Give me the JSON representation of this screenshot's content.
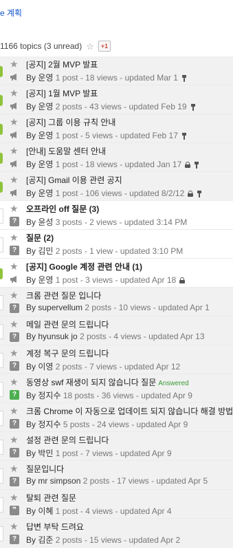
{
  "top_link": "e 계획",
  "summary": {
    "text": "1166 topics (3 unread)",
    "gplus_label": "+1"
  },
  "topics": [
    {
      "title": "[공지] 2월 MVP 발표",
      "meta_by": "By",
      "author": "운영",
      "meta": "1 post - 18 views - updated Mar 1",
      "state": "read",
      "badge": "green",
      "type": "announce",
      "pinned": true,
      "locked": false,
      "answered": false
    },
    {
      "title": "[공지] 1월 MVP 발표",
      "meta_by": "By",
      "author": "운영",
      "meta": "2 posts - 43 views - updated Feb 19",
      "state": "read",
      "badge": "green",
      "type": "announce",
      "pinned": true,
      "locked": false,
      "answered": false
    },
    {
      "title": "[공지] 그룹 이용 규칙 안내",
      "meta_by": "By",
      "author": "운영",
      "meta": "1 post - 5 views - updated Feb 17",
      "state": "read",
      "badge": "green",
      "type": "announce",
      "pinned": true,
      "locked": false,
      "answered": false
    },
    {
      "title": "[안내] 도움말 센터 안내",
      "meta_by": "By",
      "author": "운영",
      "meta": "1 post - 18 views - updated Jan 17",
      "state": "read",
      "badge": "green",
      "type": "announce",
      "pinned": true,
      "locked": true,
      "answered": false
    },
    {
      "title": "[공지] Gmail 이용 관련 공지",
      "meta_by": "By",
      "author": "운영",
      "meta": "1 post - 106 views - updated 8/2/12",
      "state": "read",
      "badge": "green",
      "type": "announce",
      "pinned": true,
      "locked": true,
      "answered": false
    },
    {
      "title": "오프라인 off 질문 (3)",
      "meta_by": "By",
      "author": "윤성",
      "meta": "3 posts - 2 views - updated 3:14 PM",
      "state": "unread",
      "badge": "white",
      "type": "q",
      "pinned": false,
      "locked": false,
      "answered": false
    },
    {
      "title": "질문 (2)",
      "meta_by": "By",
      "author": "김민",
      "meta": "2 posts - 1 view - updated 3:10 PM",
      "state": "unread",
      "badge": "white",
      "type": "q",
      "pinned": false,
      "locked": false,
      "answered": false
    },
    {
      "title": "[공지] Google 계정 관련 안내 (1)",
      "meta_by": "By",
      "author": "운영",
      "meta": "1 post - 3 views - updated Apr 18",
      "state": "unread",
      "badge": "green",
      "type": "announce",
      "pinned": false,
      "locked": true,
      "answered": false
    },
    {
      "title": "크롬 관련 질문 입니다",
      "meta_by": "By",
      "author": "supervellum",
      "meta": "2 posts - 10 views - updated Apr 1",
      "state": "read",
      "badge": "white",
      "type": "q",
      "pinned": false,
      "locked": false,
      "answered": false
    },
    {
      "title": "메일 관련 문의 드립니다",
      "meta_by": "By",
      "author": "hyunsuk jo",
      "meta": "2 posts - 4 views - updated Apr 13",
      "state": "read",
      "badge": "white",
      "type": "q",
      "pinned": false,
      "locked": false,
      "answered": false
    },
    {
      "title": "계정 복구 문의 드립니다",
      "meta_by": "By",
      "author": "이영",
      "meta": "2 posts - 7 views - updated Apr 12",
      "state": "read",
      "badge": "white",
      "type": "q",
      "pinned": false,
      "locked": false,
      "answered": false
    },
    {
      "title": "동영상 swf 재생이 되지 않습니다 질문",
      "meta_by": "By",
      "author": "정지수",
      "meta": "18 posts - 36 views - updated Apr 9",
      "state": "read",
      "badge": "white",
      "type": "a",
      "pinned": false,
      "locked": false,
      "answered": true,
      "answered_label": "Answered"
    },
    {
      "title": "크롬 Chrome 이 자동으로 업데이트 되지 않습니다 해결 방법을 알려주세요 Chrome 최신 버전 Chrome",
      "meta_by": "By",
      "author": "정지수",
      "meta": "5 posts - 24 views - updated Apr 9",
      "state": "read",
      "badge": "white",
      "type": "q",
      "pinned": false,
      "locked": false,
      "answered": false
    },
    {
      "title": "설정 관련 문의 드립니다",
      "meta_by": "By",
      "author": "박민",
      "meta": "1 post - 7 views - updated Apr 9",
      "state": "read",
      "badge": "white",
      "type": "q",
      "pinned": false,
      "locked": false,
      "answered": false
    },
    {
      "title": "질문입니다",
      "meta_by": "By",
      "author": "mr simpson",
      "meta": "2 posts - 17 views - updated Apr 5",
      "state": "read",
      "badge": "white",
      "type": "q",
      "pinned": false,
      "locked": false,
      "answered": false
    },
    {
      "title": "탈퇴 관련 질문",
      "meta_by": "By",
      "author": "이혜",
      "meta": "1 post - 4 views - updated Apr 4",
      "state": "read",
      "badge": "white",
      "type": "d",
      "pinned": false,
      "locked": false,
      "answered": false
    },
    {
      "title": "답변 부탁 드려요",
      "meta_by": "By",
      "author": "김준",
      "meta": "2 posts - 15 views - updated Apr 2",
      "state": "read",
      "badge": "white",
      "type": "q",
      "pinned": false,
      "locked": false,
      "answered": false
    }
  ]
}
